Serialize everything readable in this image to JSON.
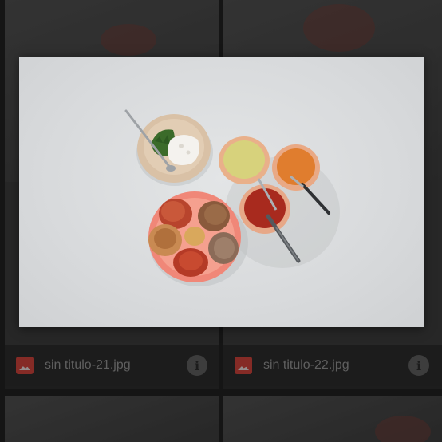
{
  "files": [
    {
      "name": "sin titulo-21.jpg"
    },
    {
      "name": "sin titulo-22.jpg"
    }
  ],
  "preview": {
    "description_icon": "photo-viewer"
  },
  "colors": {
    "file_icon": "#e0453c",
    "background": "#202020"
  }
}
